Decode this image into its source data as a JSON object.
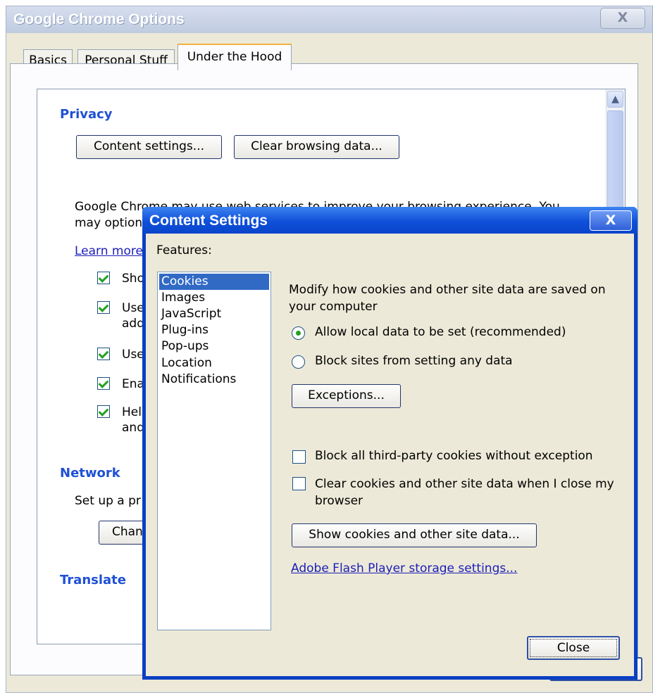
{
  "window": {
    "title": "Google Chrome Options",
    "close_glyph": "X",
    "tabs": [
      {
        "label": "Basics",
        "active": false
      },
      {
        "label": "Personal Stuff",
        "active": false
      },
      {
        "label": "Under the Hood",
        "active": true
      }
    ]
  },
  "under_the_hood": {
    "privacy_heading": "Privacy",
    "content_settings_button": "Content settings...",
    "clear_browsing_button": "Clear browsing data...",
    "web_services_text_line1": "Google Chrome may use web services to improve your browsing experience. You",
    "web_services_text_line2": "may option",
    "learn_more_link": "Learn more",
    "checkbox_fragments": [
      {
        "text": "Sho",
        "checked": true
      },
      {
        "text": "Use",
        "text2": "add",
        "checked": true
      },
      {
        "text": "Use",
        "checked": true
      },
      {
        "text": "Ena",
        "checked": true
      },
      {
        "text": "Hel",
        "text2": "and",
        "checked": true
      }
    ],
    "network_heading": "Network",
    "network_text": "Set up a pr",
    "network_button": "Chan",
    "translate_heading": "Translate"
  },
  "content_settings": {
    "title": "Content Settings",
    "close_glyph": "X",
    "features_label": "Features:",
    "features": [
      "Cookies",
      "Images",
      "JavaScript",
      "Plug-ins",
      "Pop-ups",
      "Location",
      "Notifications"
    ],
    "selected_feature": "Cookies",
    "description_line1": "Modify how cookies and other site data are saved on",
    "description_line2": "your computer",
    "radio_allow": "Allow local data to be set (recommended)",
    "radio_block": "Block sites from setting any data",
    "radio_selected": "allow",
    "exceptions_button": "Exceptions...",
    "checkbox_block_third_party": "Block all third-party cookies without exception",
    "checkbox_clear_on_close_line1": "Clear cookies and other site data when I close my",
    "checkbox_clear_on_close_line2": "browser",
    "show_cookies_button": "Show cookies and other site data...",
    "flash_link": "Adobe Flash Player storage settings...",
    "close_button": "Close"
  },
  "colors": {
    "section_heading": "#1f50d6",
    "selection": "#316ac5",
    "dialog_title": "#0f4fd9",
    "checkmark": "#21a121"
  }
}
